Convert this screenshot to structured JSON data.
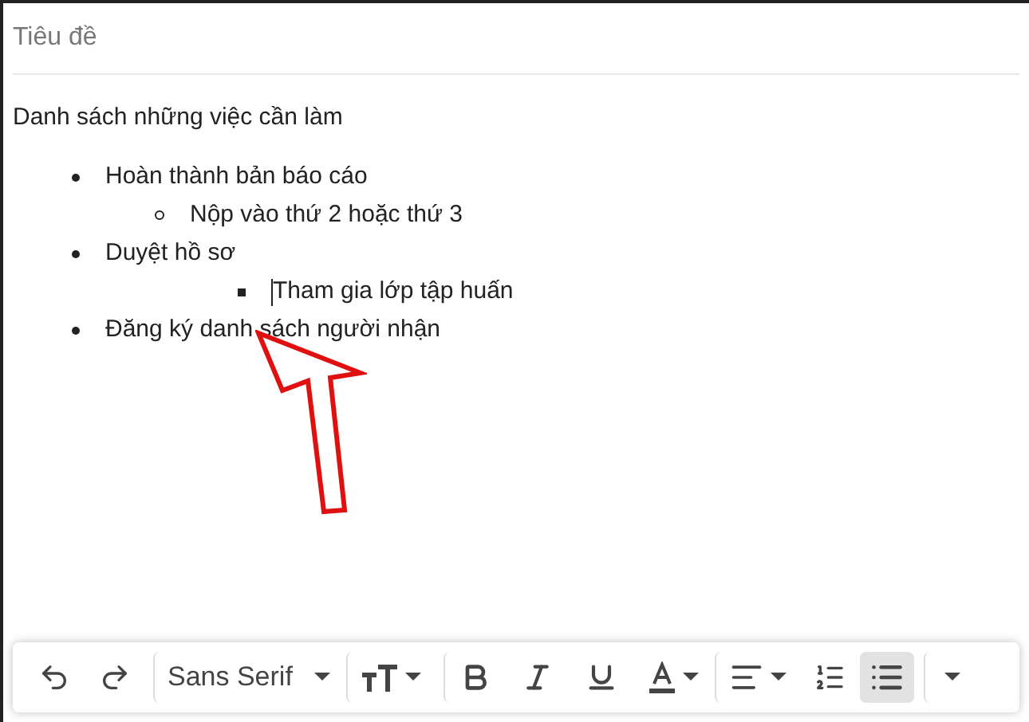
{
  "subject": {
    "placeholder": "Tiêu đề"
  },
  "body": {
    "heading": "Danh sách những việc cần làm",
    "list": [
      {
        "text": "Hoàn thành bản báo cáo",
        "children": [
          {
            "text": "Nộp vào thứ 2 hoặc thứ 3"
          }
        ]
      },
      {
        "text": "Duyệt hồ sơ",
        "children": [
          {
            "children": [
              {
                "text": "Tham gia lớp tập huấn",
                "cursor": true
              }
            ]
          }
        ]
      },
      {
        "text": "Đăng ký danh sách người nhận"
      }
    ]
  },
  "toolbar": [
    {
      "kind": "undo"
    },
    {
      "kind": "redo"
    },
    {
      "kind": "font",
      "label": "Sans Serif"
    },
    {
      "kind": "size"
    },
    {
      "kind": "bold"
    },
    {
      "kind": "italic"
    },
    {
      "kind": "underline"
    },
    {
      "kind": "color"
    },
    {
      "kind": "align"
    },
    {
      "kind": "numbered",
      "selected": false
    },
    {
      "kind": "bulleted",
      "selected": true
    },
    {
      "kind": "more"
    }
  ]
}
